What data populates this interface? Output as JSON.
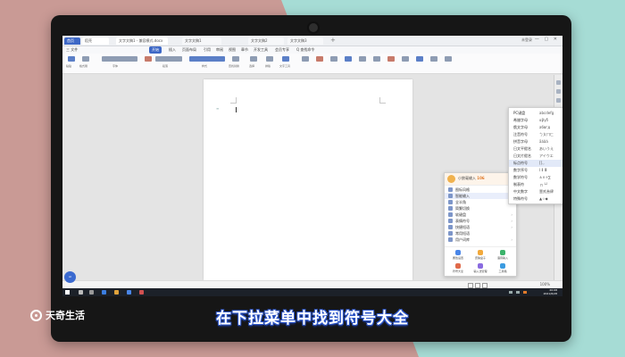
{
  "tabs": [
    {
      "label": "首页"
    },
    {
      "label": "稻壳"
    },
    {
      "label": "文字文稿1 - 兼容模式.docx"
    },
    {
      "label": "文字文稿1"
    },
    {
      "label": "文字文稿2"
    },
    {
      "label": "文字文稿3"
    }
  ],
  "user": {
    "label": "未登录"
  },
  "window_controls": "— ▢ ✕",
  "menus": [
    {
      "label": "三 文件"
    },
    {
      "label": "开始"
    },
    {
      "label": "插入"
    },
    {
      "label": "页面布局"
    },
    {
      "label": "引用"
    },
    {
      "label": "审阅"
    },
    {
      "label": "视图"
    },
    {
      "label": "章节"
    },
    {
      "label": "开发工具"
    },
    {
      "label": "会员专享"
    },
    {
      "label": "Q 查找命令"
    }
  ],
  "toolbar": [
    "粘贴",
    "格式刷",
    "字体",
    "段落",
    "样式",
    "查找替换",
    "选择",
    "排版",
    "文字工具"
  ],
  "document": {
    "cursor_mark": "≡"
  },
  "ime": {
    "name": "小狼毫输入",
    "score": "106",
    "items": [
      {
        "label": "图标风格",
        "arrow": "›"
      },
      {
        "label": "智能输入",
        "arrow": "›"
      },
      {
        "label": "全半角",
        "arrow": ""
      },
      {
        "label": "简繁切换",
        "arrow": ""
      },
      {
        "label": "软键盘",
        "arrow": "›"
      },
      {
        "label": "表情符号",
        "arrow": "›"
      },
      {
        "label": "快捷短语",
        "arrow": "›"
      },
      {
        "label": "常用短语",
        "arrow": ""
      },
      {
        "label": "用户词库",
        "arrow": "›"
      }
    ],
    "footer": [
      {
        "label": "属性设置",
        "color": "#4a86e8"
      },
      {
        "label": "皮肤盒子",
        "color": "#f2a93b"
      },
      {
        "label": "语音输入",
        "color": "#3bb36b"
      },
      {
        "label": "符号大全",
        "color": "#e06a4a"
      },
      {
        "label": "输入法管理",
        "color": "#8a6be0"
      },
      {
        "label": "工具箱",
        "color": "#3b9be0"
      }
    ]
  },
  "submenu": [
    {
      "label": "PC键盘",
      "sample": "abcdefg"
    },
    {
      "label": "希腊字母",
      "sample": "αβγδ"
    },
    {
      "label": "俄文字母",
      "sample": "абвгд"
    },
    {
      "label": "注音符号",
      "sample": "ㄅㄆㄇㄈ"
    },
    {
      "label": "拼音字母",
      "sample": "āáǎà"
    },
    {
      "label": "日文平假名",
      "sample": "あいうえ"
    },
    {
      "label": "日文片假名",
      "sample": "アイウエ"
    },
    {
      "label": "标点符号",
      "sample": "[].,"
    },
    {
      "label": "数字序号",
      "sample": "Ⅰ Ⅱ Ⅲ"
    },
    {
      "label": "数学符号",
      "sample": "±×÷∑"
    },
    {
      "label": "制表符",
      "sample": "┌┐└┘"
    },
    {
      "label": "中文数字",
      "sample": "壹贰叁肆"
    },
    {
      "label": "特殊符号",
      "sample": "▲☆◆"
    }
  ],
  "status": {
    "zoom": "100%"
  },
  "taskbar": {
    "time": "20:08",
    "date": "2021/6/28"
  },
  "ai_badge": "AI",
  "brand": {
    "name": "天奇生活"
  },
  "caption": "在下拉菜单中找到符号大全"
}
